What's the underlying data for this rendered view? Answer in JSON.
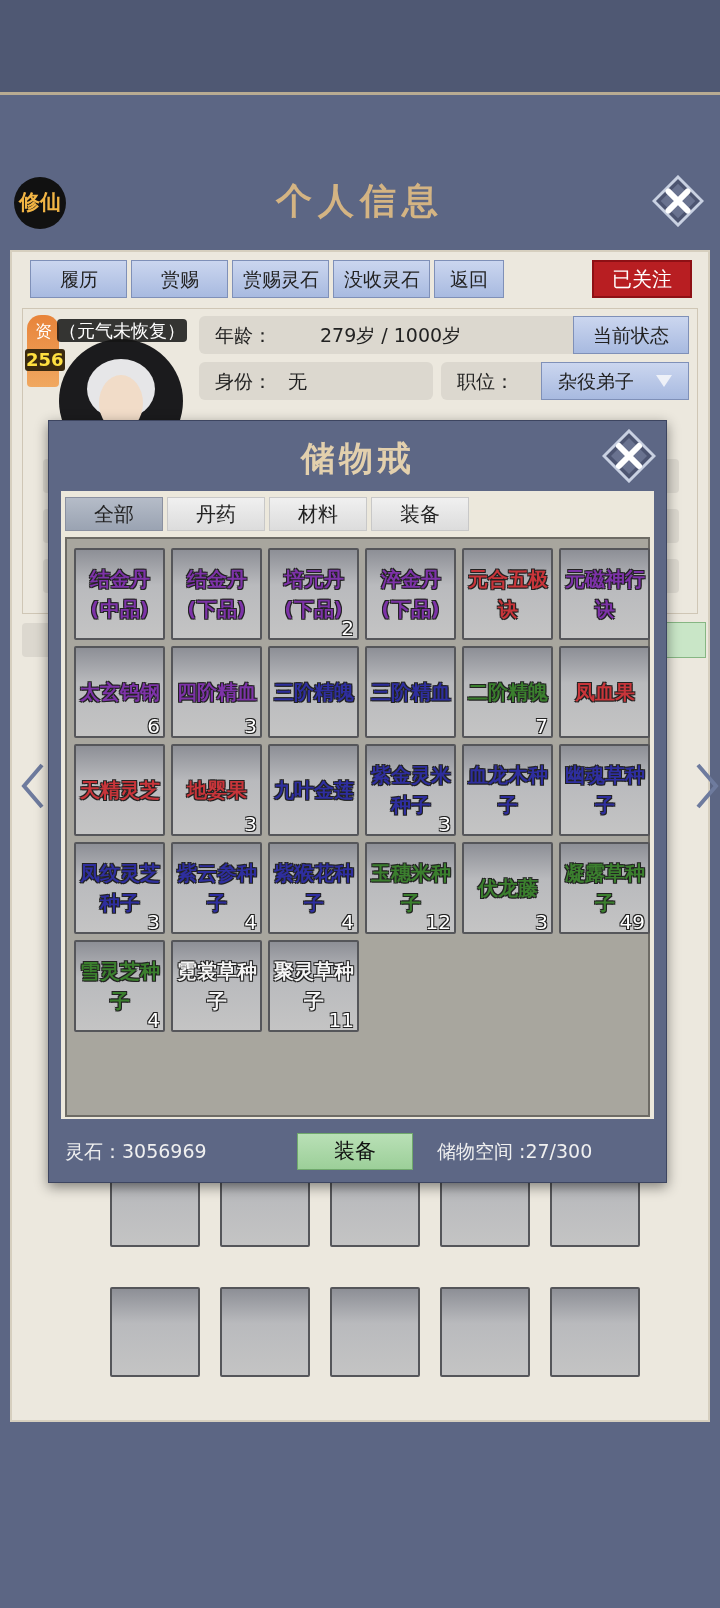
{
  "header": {
    "logo": "修仙",
    "title": "个人信息"
  },
  "profile": {
    "actions": [
      "履历",
      "赏赐",
      "赏赐灵石",
      "没收灵石",
      "返回"
    ],
    "follow": "已关注",
    "aptitude": {
      "label": "资",
      "value": "256"
    },
    "vitality": "（元气未恢复）",
    "age_label": "年龄：",
    "age_value": "279岁 / 1000岁",
    "status_button": "当前状态",
    "identity_label": "身份：",
    "identity_value": "无",
    "position_label": "职位：",
    "position_value": "杂役弟子"
  },
  "storage": {
    "title": "储物戒",
    "tabs": [
      {
        "label": "全部",
        "selected": true
      },
      {
        "label": "丹药",
        "selected": false
      },
      {
        "label": "材料",
        "selected": false
      },
      {
        "label": "装备",
        "selected": false
      }
    ],
    "items": [
      {
        "name": "结金丹(中品)",
        "color": "#7d33a8"
      },
      {
        "name": "结金丹(下品)",
        "color": "#7d33a8"
      },
      {
        "name": "培元丹(下品)",
        "count": "2",
        "color": "#7d33a8"
      },
      {
        "name": "淬金丹(下品)",
        "color": "#7d33a8"
      },
      {
        "name": "元合五极诀",
        "color": "#c8353a"
      },
      {
        "name": "元磁神行诀",
        "color": "#7d33a8"
      },
      {
        "name": "太玄钨钢",
        "count": "6",
        "color": "#7d33a8"
      },
      {
        "name": "四阶精血",
        "count": "3",
        "color": "#7d33a8"
      },
      {
        "name": "三阶精魄",
        "color": "#2e2e9e"
      },
      {
        "name": "三阶精血",
        "color": "#2e2e9e"
      },
      {
        "name": "二阶精魄",
        "count": "7",
        "color": "#3b7f2e"
      },
      {
        "name": "凤血果",
        "color": "#c8353a"
      },
      {
        "name": "天精灵芝",
        "color": "#c8353a"
      },
      {
        "name": "地婴果",
        "count": "3",
        "color": "#c8353a"
      },
      {
        "name": "九叶金莲",
        "color": "#2e2e9e"
      },
      {
        "name": "紫金灵米种子",
        "count": "3",
        "color": "#2e2e9e"
      },
      {
        "name": "血龙木种子",
        "color": "#2e2e9e"
      },
      {
        "name": "幽魂草种子",
        "color": "#2e2e9e"
      },
      {
        "name": "凤纹灵芝种子",
        "count": "3",
        "color": "#2e2e9e"
      },
      {
        "name": "紫云参种子",
        "count": "4",
        "color": "#2e2e9e"
      },
      {
        "name": "紫猴花种子",
        "count": "4",
        "color": "#2e2e9e"
      },
      {
        "name": "玉穗米种子",
        "count": "12",
        "color": "#3b7f2e"
      },
      {
        "name": "伏龙藤",
        "count": "3",
        "color": "#3b7f2e"
      },
      {
        "name": "凝露草种子",
        "count": "49",
        "color": "#3b7f2e"
      },
      {
        "name": "雪灵芝种子",
        "count": "4",
        "color": "#3b7f2e"
      },
      {
        "name": "霓裳草种子",
        "color": "#f4f4f4"
      },
      {
        "name": "聚灵草种子",
        "count": "11",
        "color": "#f4f4f4"
      }
    ],
    "spirit_stones": "灵石：3056969",
    "equip_button": "装备",
    "capacity": "储物空间 :27/300"
  }
}
